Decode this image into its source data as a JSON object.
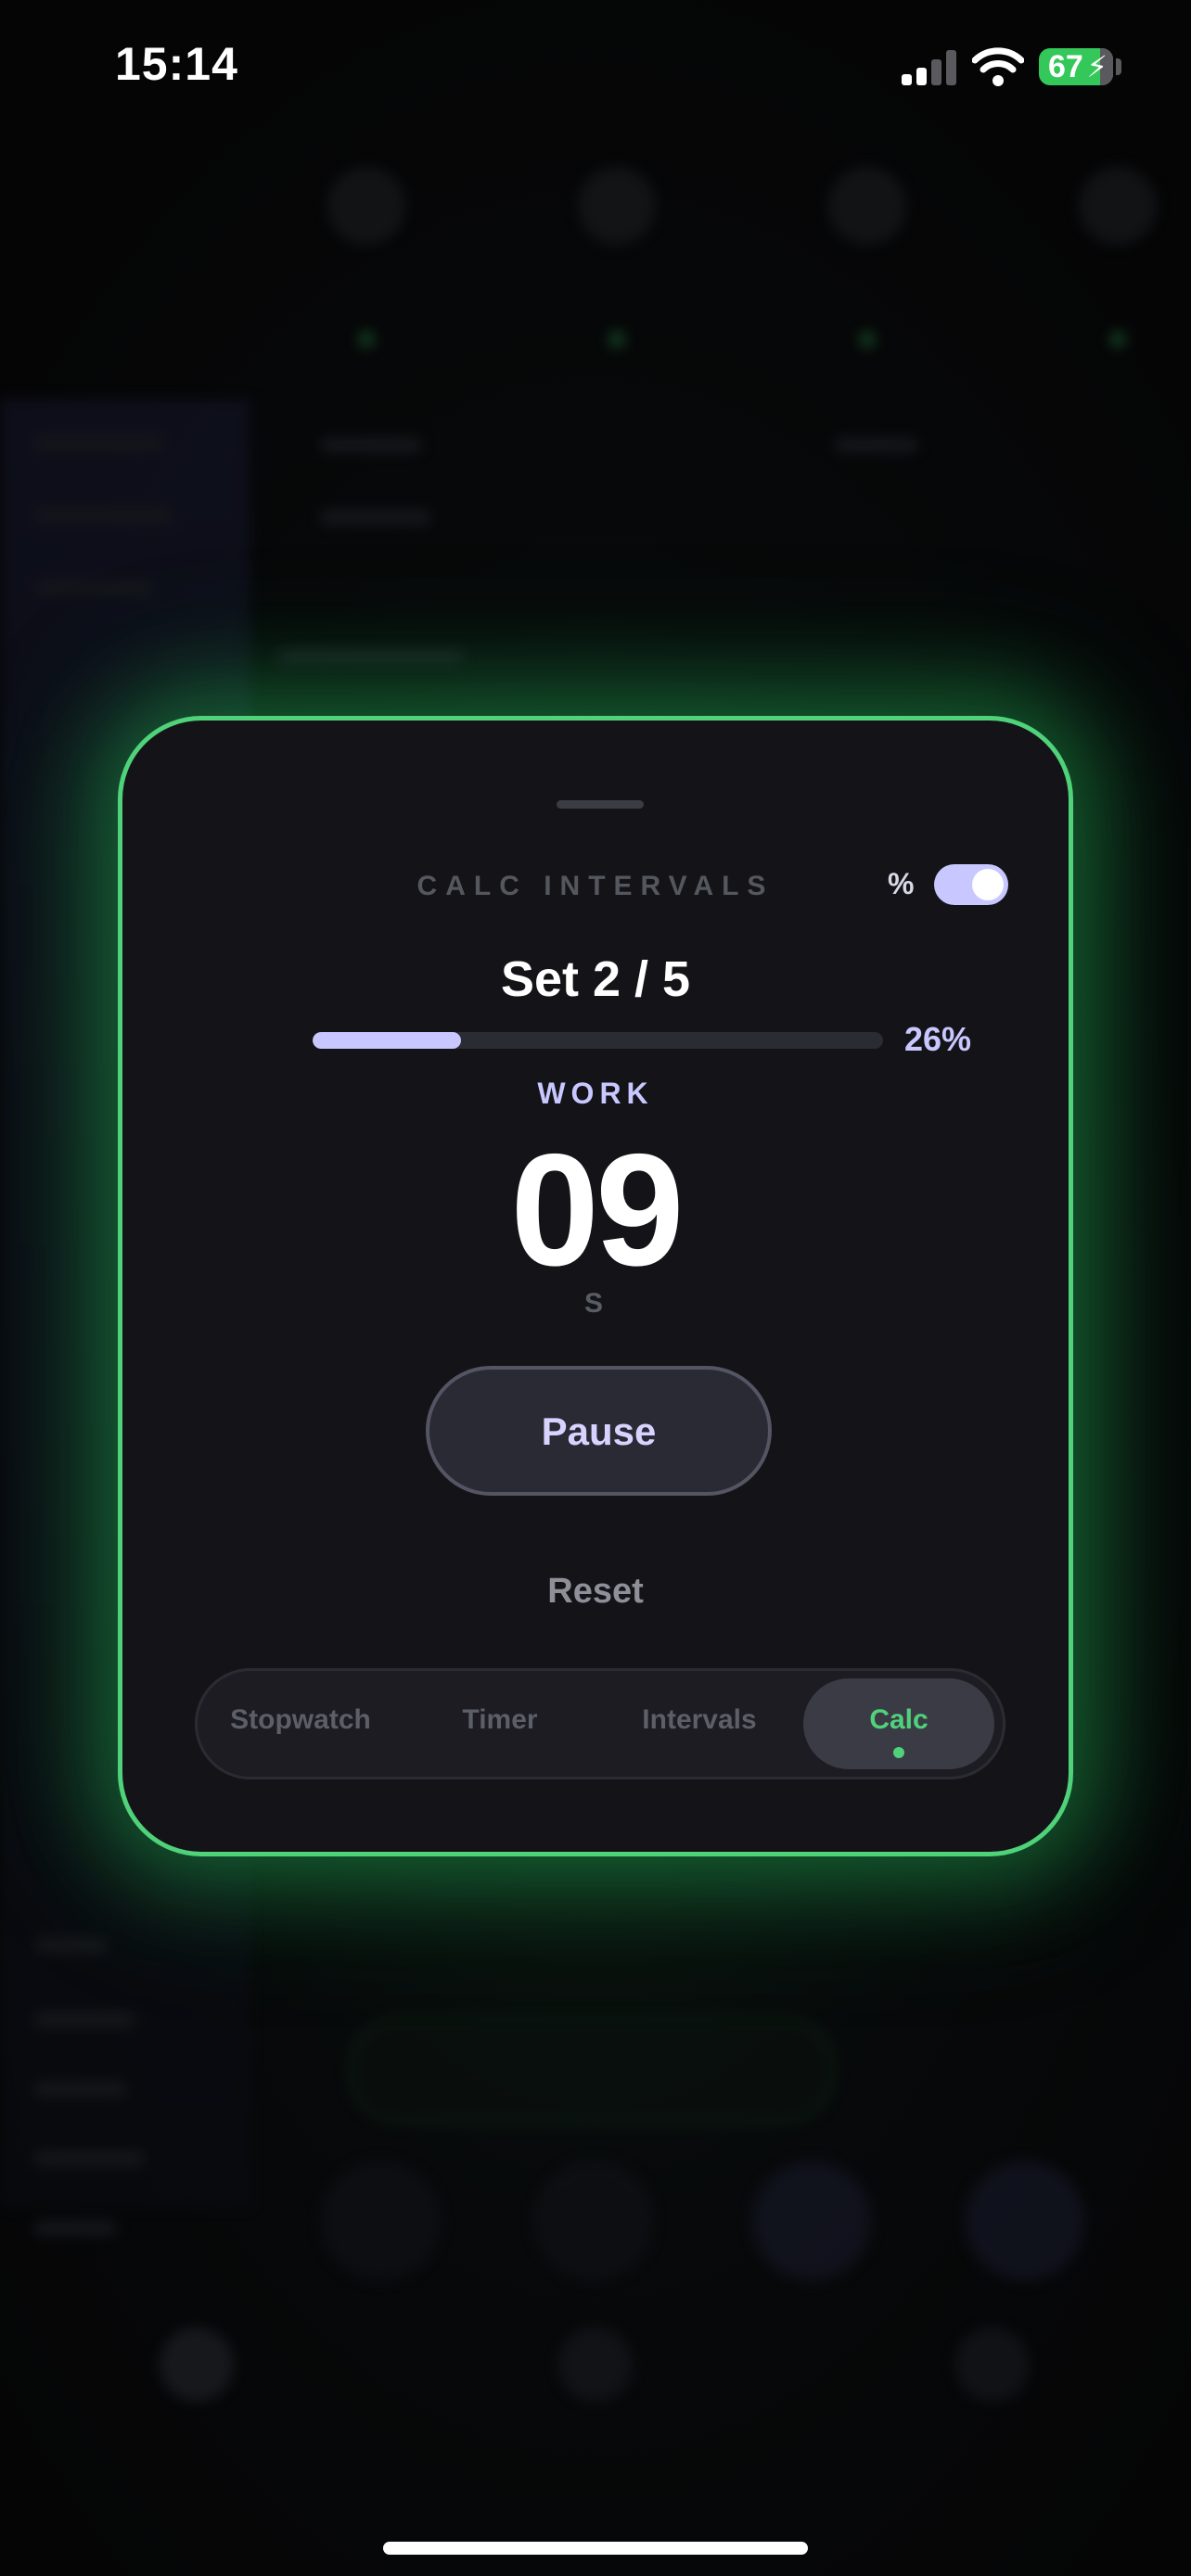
{
  "status_bar": {
    "time": "15:14",
    "battery_level": "67",
    "battery_charging": true,
    "signal_bars_active": 2,
    "signal_bars_total": 4
  },
  "card": {
    "title": "CALC INTERVALS",
    "percent_toggle_label": "%",
    "percent_toggle_on": true,
    "set_label": "Set 2 / 5",
    "progress_fraction": 0.26,
    "progress_text": "26%",
    "phase": "WORK",
    "time_value": "09",
    "time_unit": "S",
    "pause_label": "Pause",
    "reset_label": "Reset"
  },
  "mode_tabs": [
    {
      "label": "Stopwatch",
      "active": false
    },
    {
      "label": "Timer",
      "active": false
    },
    {
      "label": "Intervals",
      "active": false
    },
    {
      "label": "Calc",
      "active": true
    }
  ],
  "colors": {
    "accent_green": "#4fd27a",
    "accent_lavender": "#c9c7ff",
    "card_background": "#141418",
    "battery_green": "#34c759"
  }
}
